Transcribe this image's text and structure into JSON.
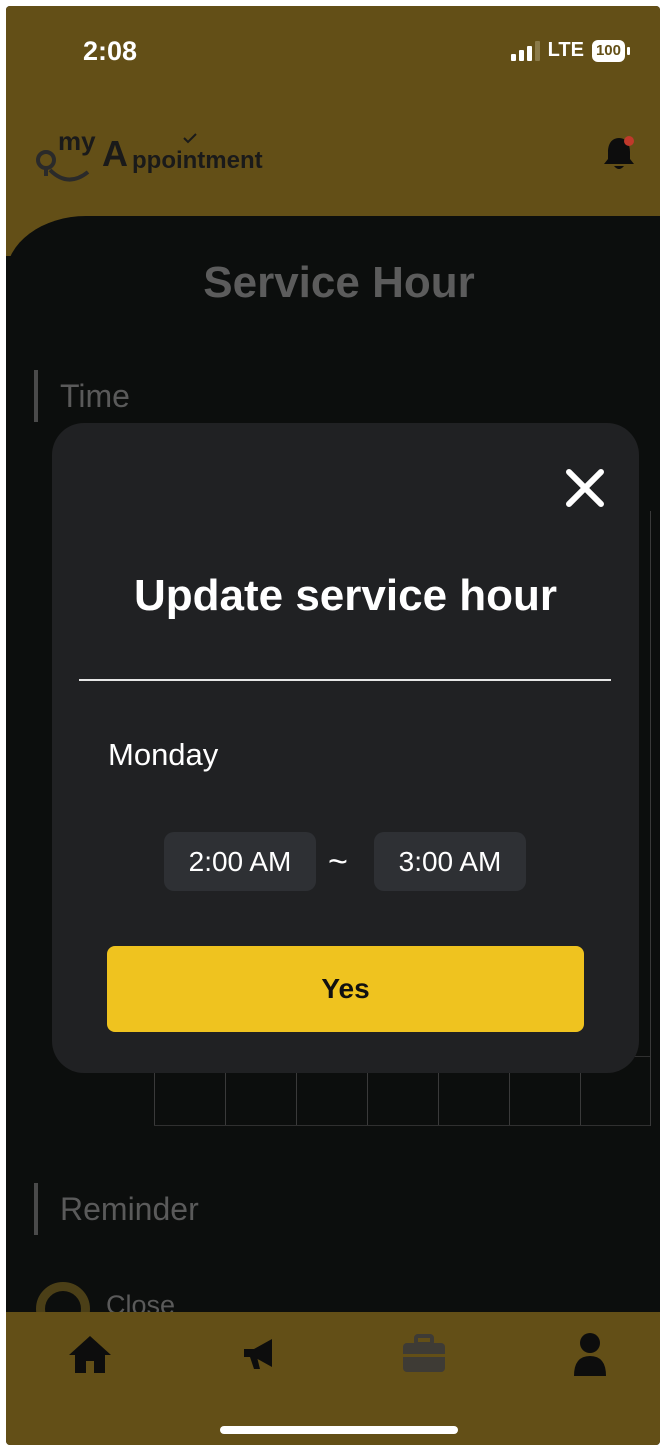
{
  "status_bar": {
    "time": "2:08",
    "network": "LTE",
    "battery": "100"
  },
  "header": {
    "logo_text_top": "my",
    "logo_text_main": "Appointment",
    "logo_letter": "A"
  },
  "page": {
    "title": "Service Hour",
    "time_section": "Time",
    "reminder_section": "Reminder",
    "reminder_option": "Close"
  },
  "modal": {
    "title": "Update service hour",
    "day": "Monday",
    "start_time": "2:00 AM",
    "separator": "~",
    "end_time": "3:00 AM",
    "confirm_label": "Yes"
  },
  "tabbar": {
    "items": [
      "home-icon",
      "megaphone-icon",
      "briefcase-icon",
      "user-icon"
    ],
    "active_index": 2
  },
  "colors": {
    "header_bg": "#634f17",
    "accent": "#efc31f",
    "modal_bg": "#202123",
    "background": "#0c0e0d"
  }
}
